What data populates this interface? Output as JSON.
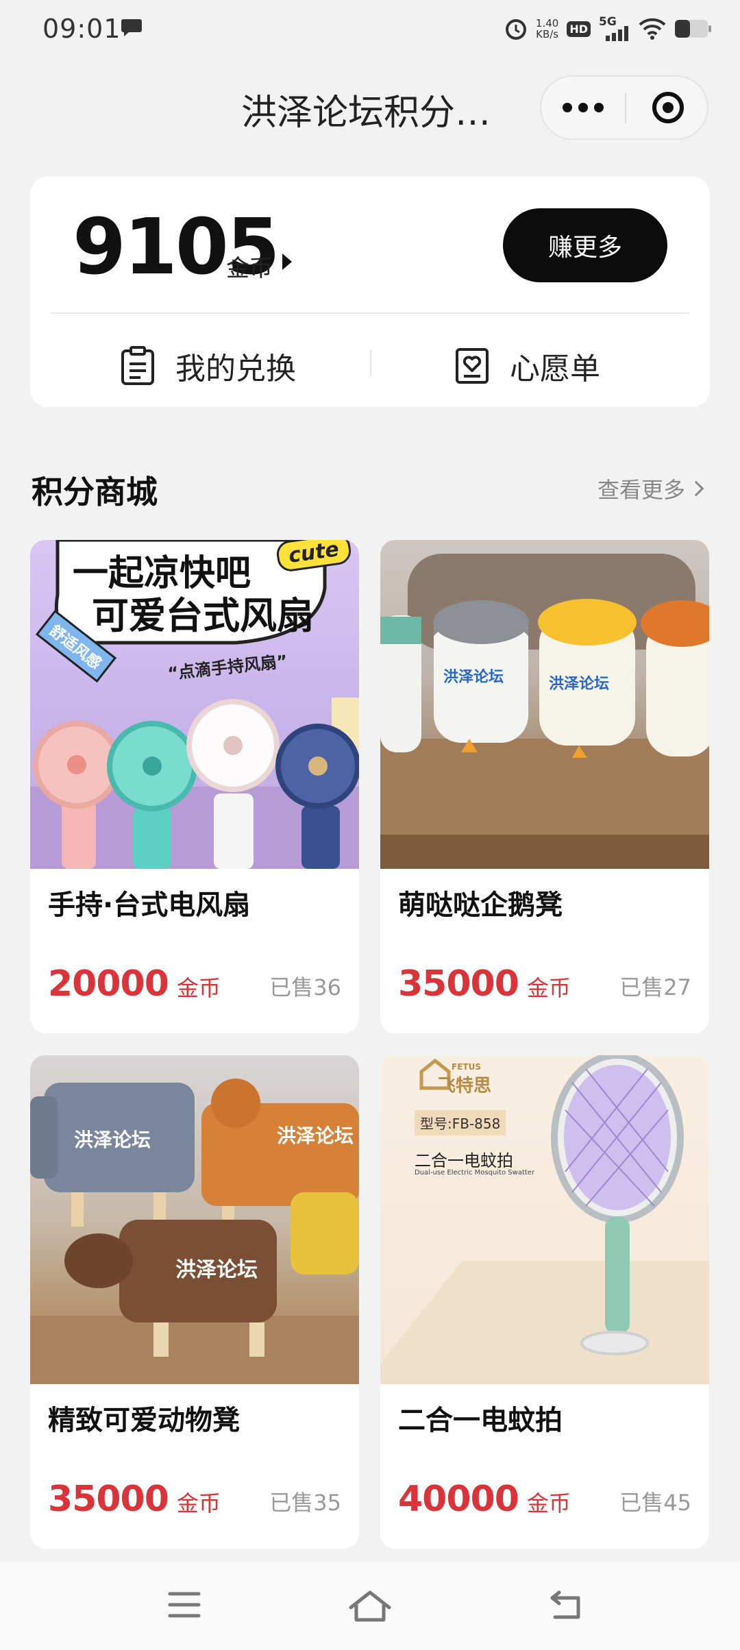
{
  "status_bar": {
    "time": "09:01",
    "net_speed_value": "1.40",
    "net_speed_unit": "KB/s",
    "hd_label": "HD",
    "signal_label": "5G"
  },
  "header": {
    "title": "洪泽论坛积分…"
  },
  "points": {
    "value": "9105",
    "unit": "金币",
    "earn_more_label": "赚更多",
    "my_exchange_label": "我的兑换",
    "wishlist_label": "心愿单"
  },
  "section": {
    "title": "积分商城",
    "more_label": "查看更多"
  },
  "products": [
    {
      "name": "手持·台式电风扇",
      "price": "20000",
      "unit": "金币",
      "sold": "已售36",
      "img_text_line1": "一起凉快吧",
      "img_text_line2": "可爱台式风扇",
      "img_badge": "cute",
      "img_ribbon": "舒适风感",
      "img_caption": "“点滴手持风扇”"
    },
    {
      "name": "萌哒哒企鹅凳",
      "price": "35000",
      "unit": "金币",
      "sold": "已售27",
      "img_label": "洪泽论坛"
    },
    {
      "name": "精致可爱动物凳",
      "price": "35000",
      "unit": "金币",
      "sold": "已售35",
      "img_label": "洪泽论坛"
    },
    {
      "name": "二合一电蚊拍",
      "price": "40000",
      "unit": "金币",
      "sold": "已售45",
      "img_brand_en": "FETUS",
      "img_brand": "飞特思",
      "img_model": "型号:FB-858",
      "img_title": "二合一电蚊拍",
      "img_subtitle": "Dual-use Electric Mosquito Swatter"
    }
  ]
}
